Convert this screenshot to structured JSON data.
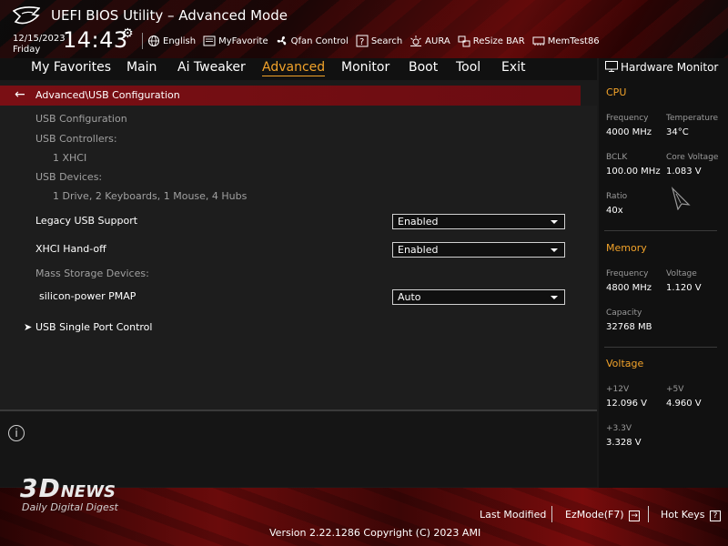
{
  "header": {
    "title": "UEFI BIOS Utility – Advanced Mode",
    "date": "12/15/2023",
    "day": "Friday",
    "time": "14:43",
    "toolbar": [
      {
        "label": "English",
        "icon": "globe-icon"
      },
      {
        "label": "MyFavorite",
        "icon": "favorite-icon"
      },
      {
        "label": "Qfan Control",
        "icon": "fan-icon"
      },
      {
        "label": "Search",
        "icon": "search-icon"
      },
      {
        "label": "AURA",
        "icon": "aura-icon"
      },
      {
        "label": "ReSize BAR",
        "icon": "resize-bar-icon"
      },
      {
        "label": "MemTest86",
        "icon": "memtest-icon"
      }
    ]
  },
  "nav": {
    "tabs": [
      "My Favorites",
      "Main",
      "Ai Tweaker",
      "Advanced",
      "Monitor",
      "Boot",
      "Tool",
      "Exit"
    ],
    "active": "Advanced"
  },
  "breadcrumb": "Advanced\\USB Configuration",
  "main": {
    "usb_configuration": "USB Configuration",
    "usb_controllers_label": "USB Controllers:",
    "usb_controllers_value": "1 XHCI",
    "usb_devices_label": "USB Devices:",
    "usb_devices_value": "1 Drive, 2 Keyboards, 1 Mouse, 4 Hubs",
    "legacy_usb_label": "Legacy USB Support",
    "legacy_usb_value": "Enabled",
    "xhci_label": "XHCI Hand-off",
    "xhci_value": "Enabled",
    "mass_storage_label": "Mass Storage Devices:",
    "device_label": "silicon-power PMAP",
    "device_value": "Auto",
    "single_port_label": "USB Single Port Control"
  },
  "hw_monitor": {
    "title": "Hardware Monitor",
    "cpu": {
      "heading": "CPU",
      "frequency_label": "Frequency",
      "frequency_value": "4000 MHz",
      "temperature_label": "Temperature",
      "temperature_value": "34°C",
      "bclk_label": "BCLK",
      "bclk_value": "100.00 MHz",
      "core_voltage_label": "Core Voltage",
      "core_voltage_value": "1.083 V",
      "ratio_label": "Ratio",
      "ratio_value": "40x"
    },
    "memory": {
      "heading": "Memory",
      "frequency_label": "Frequency",
      "frequency_value": "4800 MHz",
      "voltage_label": "Voltage",
      "voltage_value": "1.120 V",
      "capacity_label": "Capacity",
      "capacity_value": "32768 MB"
    },
    "voltage": {
      "heading": "Voltage",
      "v12_label": "+12V",
      "v12_value": "12.096 V",
      "v5_label": "+5V",
      "v5_value": "4.960 V",
      "v33_label": "+3.3V",
      "v33_value": "3.328 V"
    }
  },
  "footer": {
    "last_modified": "Last Modified",
    "ezmode": "EzMode(F7)",
    "hot_keys": "Hot Keys",
    "version": "Version 2.22.1286 Copyright (C) 2023 AMI"
  },
  "watermark": {
    "brand_3d": "3D",
    "brand_news": "NEWS",
    "tagline": "Daily Digital Digest"
  },
  "colors": {
    "accent": "#f2a32a",
    "breadcrumb_bg": "#7a0f14"
  }
}
